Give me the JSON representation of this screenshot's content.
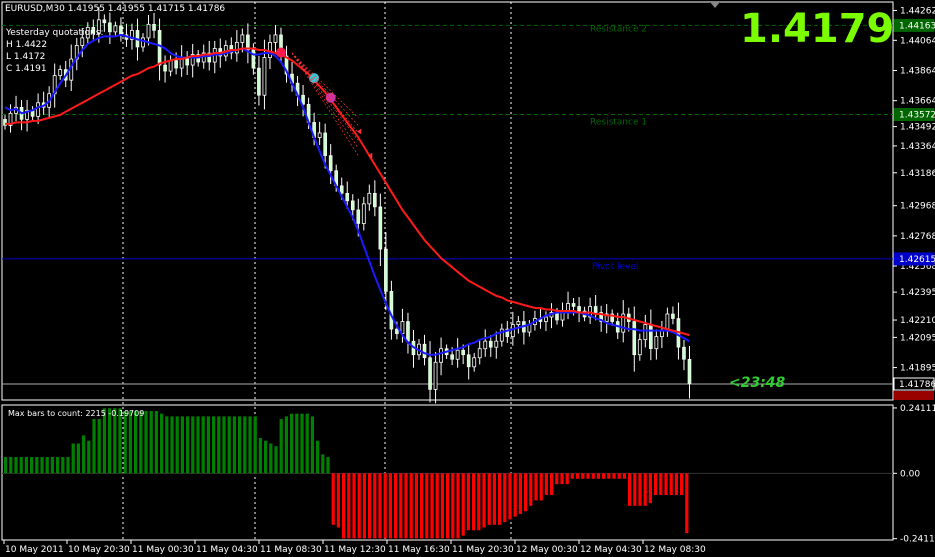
{
  "window_title": "EURUSD,M30  1.41955 1.41955 1.41715 1.41786",
  "big_price": "1.4179",
  "countdown": "<23:48",
  "yesterday": {
    "heading": "Yesterday quotations:",
    "high": "H 1.4422",
    "low": "L 1.4172",
    "close": "C 1.4191"
  },
  "levels": {
    "resistance2": "Resistance 2",
    "resistance1": "Resistance 1",
    "pivot": "Pivot level"
  },
  "colors": {
    "background": "#000000",
    "candle_body": "#ccffcc",
    "wick": "#ffffff",
    "fast_ma": "#1a1aff",
    "slow_ma": "#ff1a1a",
    "resistance": "#006600",
    "pivot": "#0000cc",
    "hist_positive": "#008000",
    "hist_negative": "#ff0000",
    "big_price": "#7cfc00"
  },
  "chart_data": [
    {
      "type": "candlestick",
      "title": "EURUSD,M30",
      "ylim": [
        1.4168,
        1.44318
      ],
      "y_ticks": [
        "1.44262",
        "1.44064",
        "1.43864",
        "1.43664",
        "1.43492",
        "1.43364",
        "1.43186",
        "1.42968",
        "1.42768",
        "1.42568",
        "1.42395",
        "1.42210",
        "1.42095",
        "1.41895"
      ],
      "x_ticks": [
        "10 May 2011",
        "10 May 20:30",
        "11 May 00:30",
        "11 May 04:30",
        "11 May 08:30",
        "11 May 12:30",
        "11 May 16:30",
        "11 May 20:30",
        "12 May 00:30",
        "12 May 04:30",
        "12 May 08:30"
      ],
      "price_tags": {
        "resistance2": "1.44163",
        "resistance1": "1.43572",
        "pivot": "1.42615",
        "current": "1.41786"
      },
      "horizontal_levels": {
        "resistance2": 1.44163,
        "resistance1": 1.43572,
        "pivot": 1.42615,
        "current": 1.41786
      },
      "closes": [
        1.435,
        1.4358,
        1.4362,
        1.4354,
        1.436,
        1.4356,
        1.4365,
        1.4362,
        1.4371,
        1.4383,
        1.4387,
        1.438,
        1.4394,
        1.4403,
        1.4408,
        1.4415,
        1.4411,
        1.442,
        1.4418,
        1.4412,
        1.4416,
        1.441,
        1.4407,
        1.4413,
        1.4402,
        1.4408,
        1.4417,
        1.4413,
        1.439,
        1.4386,
        1.4393,
        1.4388,
        1.4395,
        1.439,
        1.4397,
        1.4392,
        1.4398,
        1.4392,
        1.4401,
        1.4396,
        1.4403,
        1.4398,
        1.4405,
        1.441,
        1.44,
        1.4388,
        1.437,
        1.4395,
        1.4405,
        1.441,
        1.4396,
        1.4384,
        1.4378,
        1.437,
        1.4364,
        1.4352,
        1.4342,
        1.4345,
        1.433,
        1.432,
        1.431,
        1.4305,
        1.43,
        1.4294,
        1.4285,
        1.4298,
        1.4305,
        1.4296,
        1.4268,
        1.424,
        1.4215,
        1.4212,
        1.422,
        1.4207,
        1.4198,
        1.4205,
        1.4196,
        1.4175,
        1.4193,
        1.4202,
        1.4198,
        1.4195,
        1.4201,
        1.4198,
        1.419,
        1.4196,
        1.4202,
        1.4207,
        1.4203,
        1.4207,
        1.4215,
        1.421,
        1.4218,
        1.422,
        1.4213,
        1.4218,
        1.4222,
        1.422,
        1.4223,
        1.4226,
        1.4221,
        1.4227,
        1.4232,
        1.423,
        1.4227,
        1.4223,
        1.423,
        1.4226,
        1.422,
        1.4225,
        1.422,
        1.4213,
        1.4225,
        1.422,
        1.4198,
        1.4208,
        1.4218,
        1.4202,
        1.421,
        1.4214,
        1.4225,
        1.4222,
        1.4203,
        1.4195,
        1.4179
      ],
      "series": [
        {
          "name": "fast_ma",
          "values": [
            1.4362,
            1.436,
            1.4361,
            1.4358,
            1.4359,
            1.436,
            1.4362,
            1.4363,
            1.4366,
            1.4372,
            1.4378,
            1.4383,
            1.4389,
            1.4395,
            1.44,
            1.4404,
            1.4406,
            1.4408,
            1.4409,
            1.4409,
            1.4409,
            1.441,
            1.4409,
            1.4408,
            1.4407,
            1.4406,
            1.4405,
            1.4404,
            1.4403,
            1.4401,
            1.4398,
            1.4396,
            1.4395,
            1.4395,
            1.4395,
            1.4395,
            1.4396,
            1.4396,
            1.4397,
            1.4397,
            1.4398,
            1.4399,
            1.44,
            1.4401,
            1.4399,
            1.4397,
            1.4397,
            1.4398,
            1.4398,
            1.4396,
            1.4392,
            1.4386,
            1.4378,
            1.437,
            1.4362,
            1.4352,
            1.4342,
            1.4333,
            1.4324,
            1.4317,
            1.431,
            1.4303,
            1.4296,
            1.4289,
            1.428,
            1.427,
            1.426,
            1.425,
            1.4241,
            1.4232,
            1.4224,
            1.4217,
            1.4211,
            1.4206,
            1.4203,
            1.4201,
            1.4199,
            1.4198,
            1.4198,
            1.4199,
            1.42,
            1.4201,
            1.4202,
            1.4203,
            1.4205,
            1.4206,
            1.4208,
            1.4209,
            1.421,
            1.4212,
            1.4213,
            1.4214,
            1.4215,
            1.4216,
            1.4217,
            1.4218,
            1.422,
            1.4222,
            1.4224,
            1.4225,
            1.4226,
            1.4226,
            1.4226,
            1.4226,
            1.4226,
            1.4225,
            1.4224,
            1.4222,
            1.4221,
            1.4219,
            1.4218,
            1.4217,
            1.4216,
            1.4215,
            1.4215,
            1.4214,
            1.4214,
            1.4214,
            1.4214,
            1.4214,
            1.4214,
            1.4213,
            1.4211,
            1.4209,
            1.4207
          ]
        },
        {
          "name": "slow_ma",
          "values": [
            1.4351,
            1.4351,
            1.4352,
            1.4352,
            1.4352,
            1.4353,
            1.4353,
            1.4354,
            1.4355,
            1.4356,
            1.4357,
            1.4359,
            1.4361,
            1.4363,
            1.4365,
            1.4367,
            1.4369,
            1.4371,
            1.4373,
            1.4375,
            1.4377,
            1.4379,
            1.4381,
            1.4383,
            1.4384,
            1.4386,
            1.4388,
            1.4389,
            1.4391,
            1.4392,
            1.4393,
            1.4394,
            1.4394,
            1.4395,
            1.4396,
            1.4396,
            1.4397,
            1.4397,
            1.4398,
            1.4398,
            1.4399,
            1.44,
            1.44,
            1.4401,
            1.4401,
            1.4401,
            1.44,
            1.44,
            1.4399,
            1.4398,
            1.4397,
            1.4395,
            1.4393,
            1.439,
            1.4387,
            1.4384,
            1.438,
            1.4376,
            1.4372,
            1.4367,
            1.4362,
            1.4357,
            1.4352,
            1.4347,
            1.4342,
            1.4336,
            1.433,
            1.4324,
            1.4318,
            1.4312,
            1.4306,
            1.43,
            1.4294,
            1.4289,
            1.4284,
            1.4279,
            1.4274,
            1.427,
            1.4266,
            1.4262,
            1.4259,
            1.4256,
            1.4253,
            1.425,
            1.4247,
            1.4245,
            1.4243,
            1.4241,
            1.4239,
            1.4237,
            1.4236,
            1.4234,
            1.4233,
            1.4232,
            1.4231,
            1.423,
            1.4229,
            1.4229,
            1.4228,
            1.4228,
            1.4227,
            1.4227,
            1.4227,
            1.4227,
            1.4226,
            1.4226,
            1.4226,
            1.4225,
            1.4225,
            1.4224,
            1.4224,
            1.4223,
            1.4223,
            1.4222,
            1.4221,
            1.422,
            1.4219,
            1.4218,
            1.4217,
            1.4216,
            1.4215,
            1.4214,
            1.4213,
            1.4212,
            1.4211
          ]
        }
      ]
    },
    {
      "type": "bar",
      "title": "Max bars to count: 2215  -0.19709",
      "ylim": [
        -0.246,
        0.252
      ],
      "y_ticks": [
        "0.24111",
        "0.00",
        "-0.24111"
      ],
      "values": [
        0.06,
        0.06,
        0.06,
        0.06,
        0.06,
        0.06,
        0.06,
        0.06,
        0.06,
        0.06,
        0.06,
        0.06,
        0.06,
        0.11,
        0.11,
        0.14,
        0.12,
        0.2,
        0.2,
        0.24,
        0.24,
        0.24,
        0.24,
        0.23,
        0.23,
        0.23,
        0.23,
        0.23,
        0.23,
        0.23,
        0.22,
        0.21,
        0.21,
        0.21,
        0.21,
        0.21,
        0.21,
        0.21,
        0.21,
        0.21,
        0.21,
        0.21,
        0.21,
        0.21,
        0.21,
        0.21,
        0.21,
        0.21,
        0.21,
        0.13,
        0.12,
        0.11,
        0.1,
        0.2,
        0.21,
        0.22,
        0.22,
        0.22,
        0.22,
        0.21,
        0.12,
        0.07,
        0.06,
        -0.19,
        -0.2,
        -0.24,
        -0.24,
        -0.24,
        -0.24,
        -0.24,
        -0.24,
        -0.24,
        -0.24,
        -0.24,
        -0.24,
        -0.24,
        -0.24,
        -0.24,
        -0.24,
        -0.24,
        -0.24,
        -0.24,
        -0.24,
        -0.24,
        -0.24,
        -0.24,
        -0.24,
        -0.24,
        -0.23,
        -0.21,
        -0.21,
        -0.21,
        -0.2,
        -0.19,
        -0.19,
        -0.19,
        -0.18,
        -0.17,
        -0.16,
        -0.15,
        -0.14,
        -0.12,
        -0.1,
        -0.1,
        -0.08,
        -0.08,
        -0.04,
        -0.04,
        -0.04,
        -0.02,
        -0.02,
        -0.02,
        -0.02,
        -0.02,
        -0.02,
        -0.02,
        -0.02,
        -0.02,
        -0.02,
        -0.02,
        -0.12,
        -0.12,
        -0.12,
        -0.12,
        -0.11,
        -0.08,
        -0.08,
        -0.08,
        -0.08,
        -0.08,
        -0.08,
        -0.22
      ]
    }
  ]
}
